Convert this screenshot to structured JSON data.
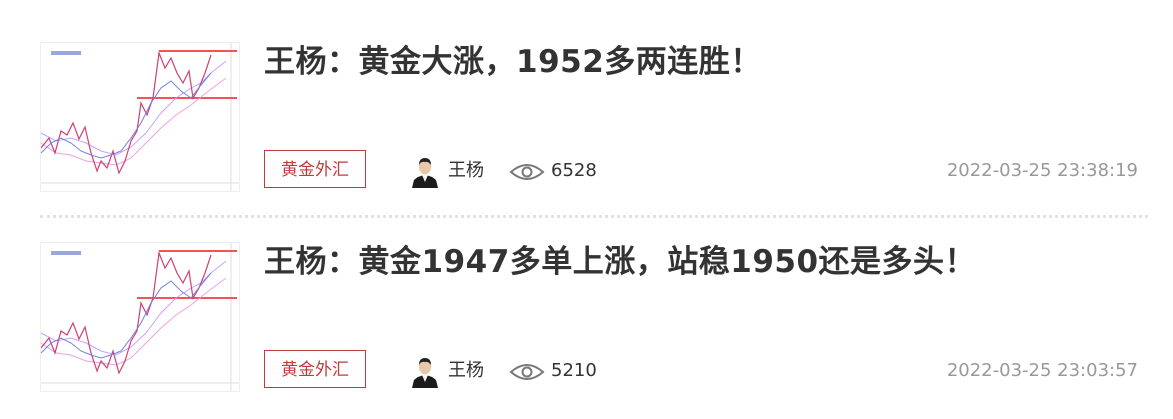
{
  "articles": [
    {
      "title": "王杨：黄金大涨，1952多两连胜！",
      "tag": "黄金外汇",
      "author": "王杨",
      "views": "6528",
      "time": "2022-03-25 23:38:19"
    },
    {
      "title": "王杨：黄金1947多单上涨，站稳1950还是多头！",
      "tag": "黄金外汇",
      "author": "王杨",
      "views": "5210",
      "time": "2022-03-25 23:03:57"
    }
  ],
  "colors": {
    "tag": "#c23b3b",
    "title": "#333333",
    "meta": "#999999"
  },
  "icons": {
    "views": "eye-icon",
    "author": "avatar"
  }
}
